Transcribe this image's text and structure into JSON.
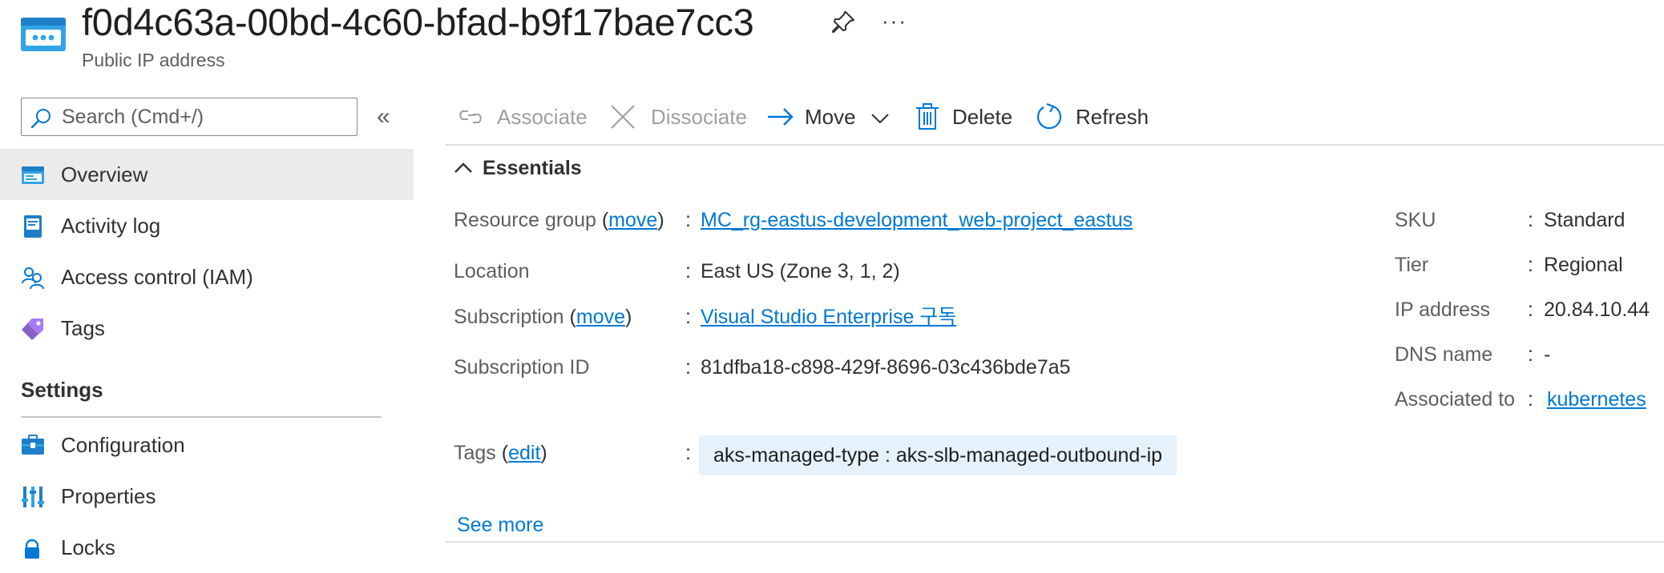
{
  "header": {
    "title": "f0d4c63a-00bd-4c60-bfad-b9f17bae7cc3",
    "subtitle": "Public IP address",
    "more_label": "···"
  },
  "sidebar": {
    "search_placeholder": "Search (Cmd+/)",
    "collapse_label": "«",
    "items": [
      {
        "label": "Overview",
        "icon": "overview-icon",
        "active": true
      },
      {
        "label": "Activity log",
        "icon": "activity-log-icon"
      },
      {
        "label": "Access control (IAM)",
        "icon": "people-icon"
      },
      {
        "label": "Tags",
        "icon": "tag-icon"
      }
    ],
    "settings_heading": "Settings",
    "settings_items": [
      {
        "label": "Configuration",
        "icon": "configuration-icon"
      },
      {
        "label": "Properties",
        "icon": "properties-icon"
      },
      {
        "label": "Locks",
        "icon": "lock-icon"
      }
    ]
  },
  "toolbar": {
    "associate": "Associate",
    "dissociate": "Dissociate",
    "move": "Move",
    "delete": "Delete",
    "refresh": "Refresh"
  },
  "essentials": {
    "heading": "Essentials",
    "resource_group": {
      "label": "Resource group",
      "action": "move",
      "value": "MC_rg-eastus-development_web-project_eastus"
    },
    "location": {
      "label": "Location",
      "value": "East US (Zone 3, 1, 2)"
    },
    "subscription": {
      "label": "Subscription",
      "action": "move",
      "value": "Visual Studio Enterprise 구독"
    },
    "subscription_id": {
      "label": "Subscription ID",
      "value": "81dfba18-c898-429f-8696-03c436bde7a5"
    },
    "tags": {
      "label": "Tags",
      "action": "edit",
      "value": "aks-managed-type : aks-slb-managed-outbound-ip"
    },
    "right": {
      "sku": {
        "label": "SKU",
        "value": "Standard"
      },
      "tier": {
        "label": "Tier",
        "value": "Regional"
      },
      "ip_address": {
        "label": "IP address",
        "value": "20.84.10.44"
      },
      "dns_name": {
        "label": "DNS name",
        "value": "-"
      },
      "associated_to": {
        "label": "Associated to",
        "value": "kubernetes"
      }
    },
    "colon": ":",
    "see_more": "See more"
  },
  "colors": {
    "accent": "#0078d4",
    "active_nav_bg": "#edebe9",
    "tag_bg": "#e5f1fb"
  }
}
